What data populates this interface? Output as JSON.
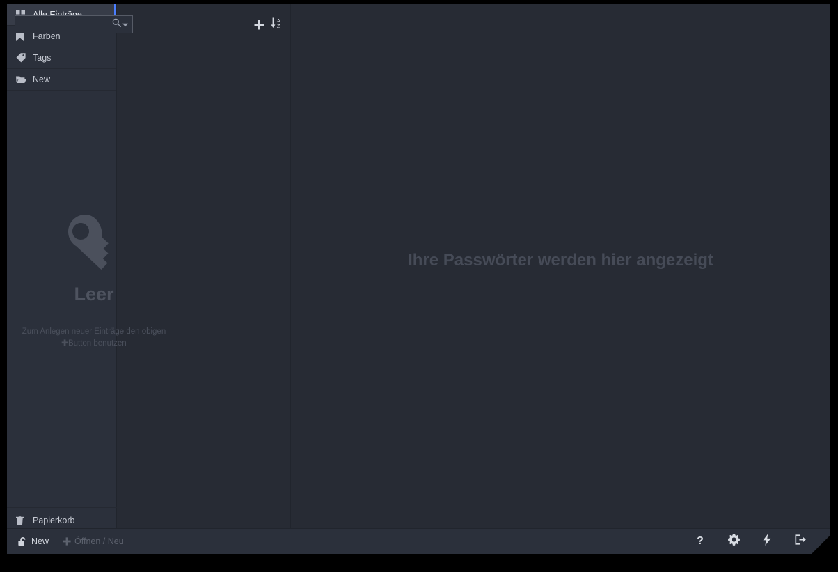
{
  "window": {
    "background": "#272b34",
    "accent": "#4a7eff"
  },
  "sidebar": {
    "items": [
      {
        "label": "Alle Einträge",
        "icon": "grid-icon",
        "active": true
      },
      {
        "label": "Farben",
        "icon": "bookmark-icon",
        "active": false
      },
      {
        "label": "Tags",
        "icon": "tag-icon",
        "active": false
      },
      {
        "label": "New",
        "icon": "folder-open-icon",
        "active": false
      }
    ],
    "trash": {
      "label": "Papierkorb",
      "icon": "trash-icon"
    }
  },
  "list_pane": {
    "search": {
      "value": "",
      "placeholder": "",
      "icon": "search-icon",
      "dropdown_icon": "caret-down-icon"
    },
    "add_button": {
      "label": "+",
      "icon": "plus-icon"
    },
    "sort_button": {
      "icon": "sort-alpha-down-icon"
    },
    "empty_state": {
      "icon": "key-icon",
      "title": "Leer",
      "description_line1": "Zum Anlegen neuer Einträge den obigen",
      "description_plus": "✚",
      "description_line2": "Button benutzen"
    }
  },
  "main_pane": {
    "placeholder": "Ihre Passwörter werden hier angezeigt"
  },
  "bottom_bar": {
    "tabs": [
      {
        "label": "New",
        "icon": "unlock-icon",
        "active": true
      },
      {
        "label": "Öffnen / Neu",
        "icon": "plus-icon",
        "active": false
      }
    ],
    "actions": [
      {
        "name": "help",
        "icon": "question-mark-icon",
        "label": "?"
      },
      {
        "name": "settings",
        "icon": "gear-icon",
        "label": ""
      },
      {
        "name": "quick-actions",
        "icon": "lightning-bolt-icon",
        "label": ""
      },
      {
        "name": "logout",
        "icon": "exit-icon",
        "label": ""
      }
    ]
  }
}
